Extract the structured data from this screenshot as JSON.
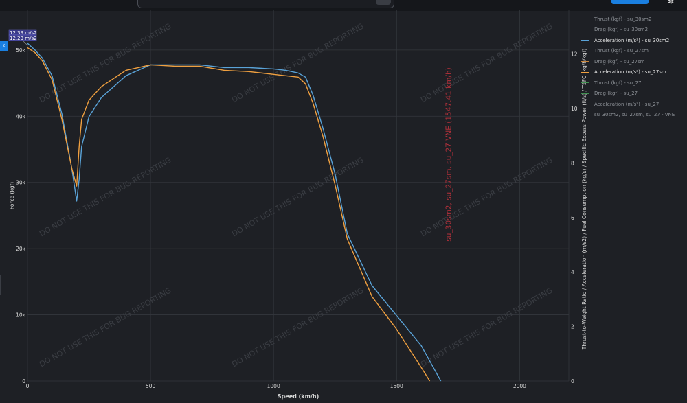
{
  "ui": {
    "collapse_icon": "chevron-left-icon",
    "settings_icon": "gear-icon",
    "collapse_glyph": "‹",
    "gear_glyph": "✲"
  },
  "colors": {
    "background": "#1e2025",
    "grid": "#34373d",
    "axis_text": "#d8d8d8",
    "series_blue": "#5aa3d8",
    "series_orange": "#f0a040",
    "series_green": "#3f8f4f",
    "vne": "#b0303a",
    "watermark": "#3a3d43",
    "accent": "#1a7fe0"
  },
  "chart_data": {
    "type": "line",
    "xlabel": "Speed (km/h)",
    "ylabel_left": "Force (kgf)",
    "ylabel_right": "Thrust-to-Weight Ratio / Acceleration (m/s2) / Fuel Consumption (kg/s) / Specific Excess Power (ft/s) / TSFC (kg/h/kgf)",
    "xlim": [
      0,
      2200
    ],
    "ylim_left": [
      0,
      56000
    ],
    "ylim_right": [
      0,
      13.6
    ],
    "x_ticks": [
      0,
      500,
      1000,
      1500,
      2000
    ],
    "x_tick_labels": [
      "0",
      "500",
      "1000",
      "1500",
      "2000"
    ],
    "y_left_ticks": [
      0,
      10000,
      20000,
      30000,
      40000,
      50000
    ],
    "y_left_tick_labels": [
      "0",
      "10k",
      "20k",
      "30k",
      "40k",
      "50k"
    ],
    "y_right_ticks": [
      0,
      2,
      4,
      6,
      8,
      10,
      12
    ],
    "y_right_tick_labels": [
      "0",
      "2",
      "4",
      "6",
      "8",
      "10",
      "12"
    ],
    "grid": true,
    "legend_position": "right",
    "watermark": "DO NOT USE THIS FOR BUG REPORTING",
    "hover_labels": [
      "12.39 m/s2",
      "12.23 m/s2"
    ],
    "vne_line": {
      "x": 1547.41,
      "label": "su_30sm2, su_27sm, su_27 VNE (1547.41 km/h)"
    },
    "legend": [
      {
        "name": "Thrust (kgf) - su_30sm2",
        "color": "#3f7fae",
        "active": false
      },
      {
        "name": "Drag (kgf) - su_30sm2",
        "color": "#3f7fae",
        "active": false
      },
      {
        "name": "Acceleration (m/s²) - su_30sm2",
        "color": "#5aa3d8",
        "active": true
      },
      {
        "name": "Thrust (kgf) - su_27sm",
        "color": "#c8843a",
        "active": false
      },
      {
        "name": "Drag (kgf) - su_27sm",
        "color": "#c8843a",
        "active": false
      },
      {
        "name": "Acceleration (m/s²) - su_27sm",
        "color": "#f0a040",
        "active": true
      },
      {
        "name": "Thrust (kgf) - su_27",
        "color": "#3f8f4f",
        "active": false
      },
      {
        "name": "Drag (kgf) - su_27",
        "color": "#3f8f4f",
        "active": false
      },
      {
        "name": "Acceleration (m/s²) - su_27",
        "color": "#3f8f4f",
        "active": false
      },
      {
        "name": "su_30sm2, su_27sm, su_27 - VNE",
        "color": "#b0303a",
        "active": false
      }
    ],
    "series": [
      {
        "name": "Acceleration (m/s²) - su_30sm2",
        "axis": "right",
        "color": "#5aa3d8",
        "x": [
          0,
          30,
          60,
          100,
          140,
          180,
          200,
          210,
          220,
          250,
          300,
          400,
          500,
          600,
          700,
          800,
          900,
          1000,
          1050,
          1100,
          1130,
          1160,
          1200,
          1250,
          1300,
          1400,
          1500,
          1600,
          1680
        ],
        "y": [
          12.39,
          12.15,
          11.85,
          11.2,
          9.8,
          7.8,
          6.6,
          7.4,
          8.6,
          9.7,
          10.4,
          11.2,
          11.6,
          11.6,
          11.6,
          11.5,
          11.5,
          11.45,
          11.4,
          11.3,
          11.15,
          10.5,
          9.3,
          7.6,
          5.4,
          3.5,
          2.4,
          1.3,
          0.0
        ]
      },
      {
        "name": "Acceleration (m/s²) - su_27sm",
        "axis": "right",
        "color": "#f0a040",
        "x": [
          0,
          30,
          60,
          100,
          140,
          180,
          200,
          210,
          220,
          250,
          300,
          400,
          500,
          600,
          700,
          800,
          900,
          1000,
          1050,
          1100,
          1130,
          1160,
          1200,
          1250,
          1300,
          1400,
          1500,
          1600,
          1635
        ],
        "y": [
          12.23,
          12.05,
          11.75,
          11.05,
          9.6,
          7.8,
          7.15,
          8.6,
          9.6,
          10.3,
          10.8,
          11.4,
          11.6,
          11.55,
          11.55,
          11.4,
          11.35,
          11.25,
          11.2,
          11.15,
          10.9,
          10.2,
          9.0,
          7.2,
          5.2,
          3.1,
          1.9,
          0.5,
          0.0
        ]
      }
    ]
  }
}
